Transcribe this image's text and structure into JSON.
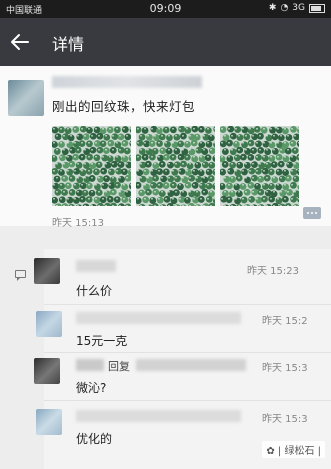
{
  "status_bar": {
    "carrier": "中国联通",
    "time": "09:09",
    "network": "3G"
  },
  "title_bar": {
    "title": "详情"
  },
  "post": {
    "text": "刚出的回纹珠，快来灯包",
    "time": "昨天 15:13",
    "photo_count": 3,
    "photo_color": "#3f7a4f"
  },
  "comments": [
    {
      "text": "什么价",
      "time": "昨天 15:23"
    },
    {
      "text": "15元一克",
      "time": "昨天 15:2"
    },
    {
      "name_fragment": "回复",
      "text": "微沁?",
      "time": "昨天 15:3"
    },
    {
      "text": "优化的",
      "time": "昨天 15:3"
    }
  ],
  "watermark": {
    "text": "| 绿松石 |"
  }
}
